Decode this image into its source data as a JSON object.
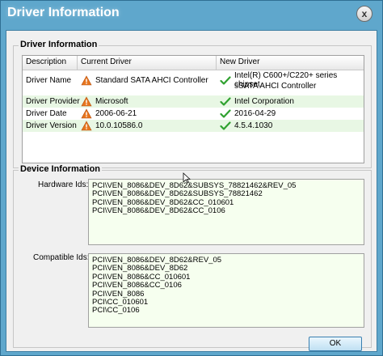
{
  "window": {
    "title": "Driver Information",
    "close_glyph": "x"
  },
  "driver_group": {
    "title": "Driver Information",
    "columns": [
      "Description",
      "Current Driver",
      "New Driver"
    ],
    "rows": [
      {
        "desc": "Driver Name",
        "current": "Standard SATA AHCI Controller",
        "new_line1": "Intel(R) C600+/C220+ series chipset",
        "new_line2": "sSATA AHCI Controller"
      },
      {
        "desc": "Driver Provider",
        "current": "Microsoft",
        "new_line1": "Intel Corporation"
      },
      {
        "desc": "Driver Date",
        "current": "2006-06-21",
        "new_line1": "2016-04-29"
      },
      {
        "desc": "Driver Version",
        "current": "10.0.10586.0",
        "new_line1": "4.5.4.1030"
      }
    ],
    "current_icon": "warning-icon",
    "new_icon": "checkmark-icon"
  },
  "device_group": {
    "title": "Device Information",
    "hardware_label": "Hardware Ids:",
    "hardware_ids": [
      "PCI\\VEN_8086&DEV_8D62&SUBSYS_78821462&REV_05",
      "PCI\\VEN_8086&DEV_8D62&SUBSYS_78821462",
      "PCI\\VEN_8086&DEV_8D62&CC_010601",
      "PCI\\VEN_8086&DEV_8D62&CC_0106"
    ],
    "compatible_label": "Compatible Ids:",
    "compatible_ids": [
      "PCI\\VEN_8086&DEV_8D62&REV_05",
      "PCI\\VEN_8086&DEV_8D62",
      "PCI\\VEN_8086&CC_010601",
      "PCI\\VEN_8086&CC_0106",
      "PCI\\VEN_8086",
      "PCI\\CC_010601",
      "PCI\\CC_0106"
    ]
  },
  "buttons": {
    "ok_label": "OK"
  },
  "colors": {
    "title_bar": "#5fa7cc",
    "textarea_bg": "#f6ffef",
    "row_alt": "#e8f7e4",
    "warning": "#e8761f",
    "check": "#2fa12f"
  }
}
